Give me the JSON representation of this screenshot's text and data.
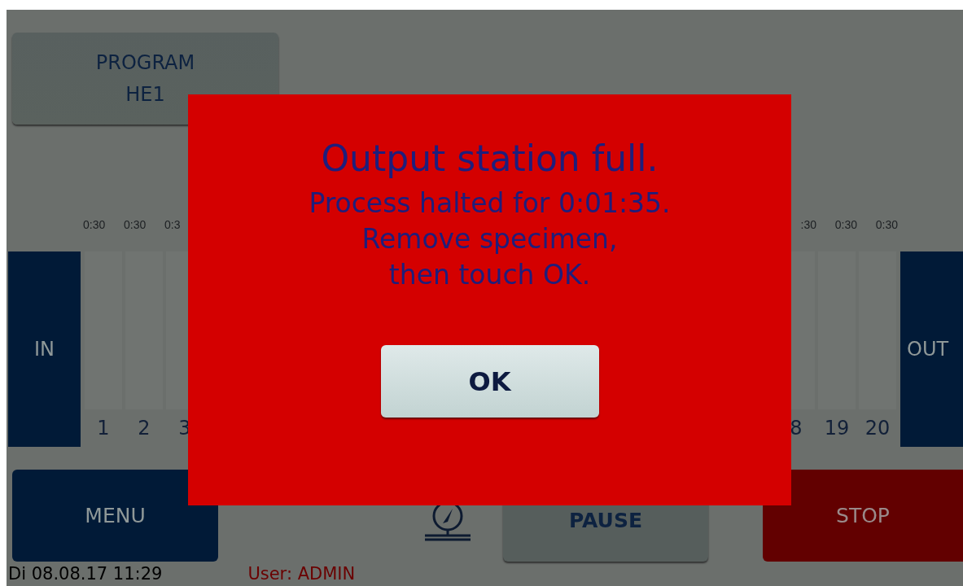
{
  "program_button": {
    "label": "PROGRAM",
    "value": "HE1"
  },
  "stations": {
    "in_label": "IN",
    "out_label": "OUT",
    "left": [
      {
        "time": "0:30",
        "number": "1"
      },
      {
        "time": "0:30",
        "number": "2"
      },
      {
        "time": "0:3",
        "number": "3"
      }
    ],
    "right": [
      {
        "time": ":30",
        "number": "8"
      },
      {
        "time": "0:30",
        "number": "19"
      },
      {
        "time": "0:30",
        "number": "20"
      }
    ]
  },
  "dialog": {
    "title": "Output station full.",
    "lines": [
      "Process halted for 0:01:35.",
      "Remove specimen,",
      "then touch OK."
    ],
    "button": "OK"
  },
  "buttons": [
    {
      "label": "MENU",
      "kind": "menu"
    },
    {
      "label": "PAUSE",
      "kind": "pause"
    },
    {
      "label": "STOP",
      "kind": "stop"
    }
  ],
  "status_bar": {
    "datetime": "Di 08.08.17 11:29",
    "user": "User: ADMIN"
  }
}
